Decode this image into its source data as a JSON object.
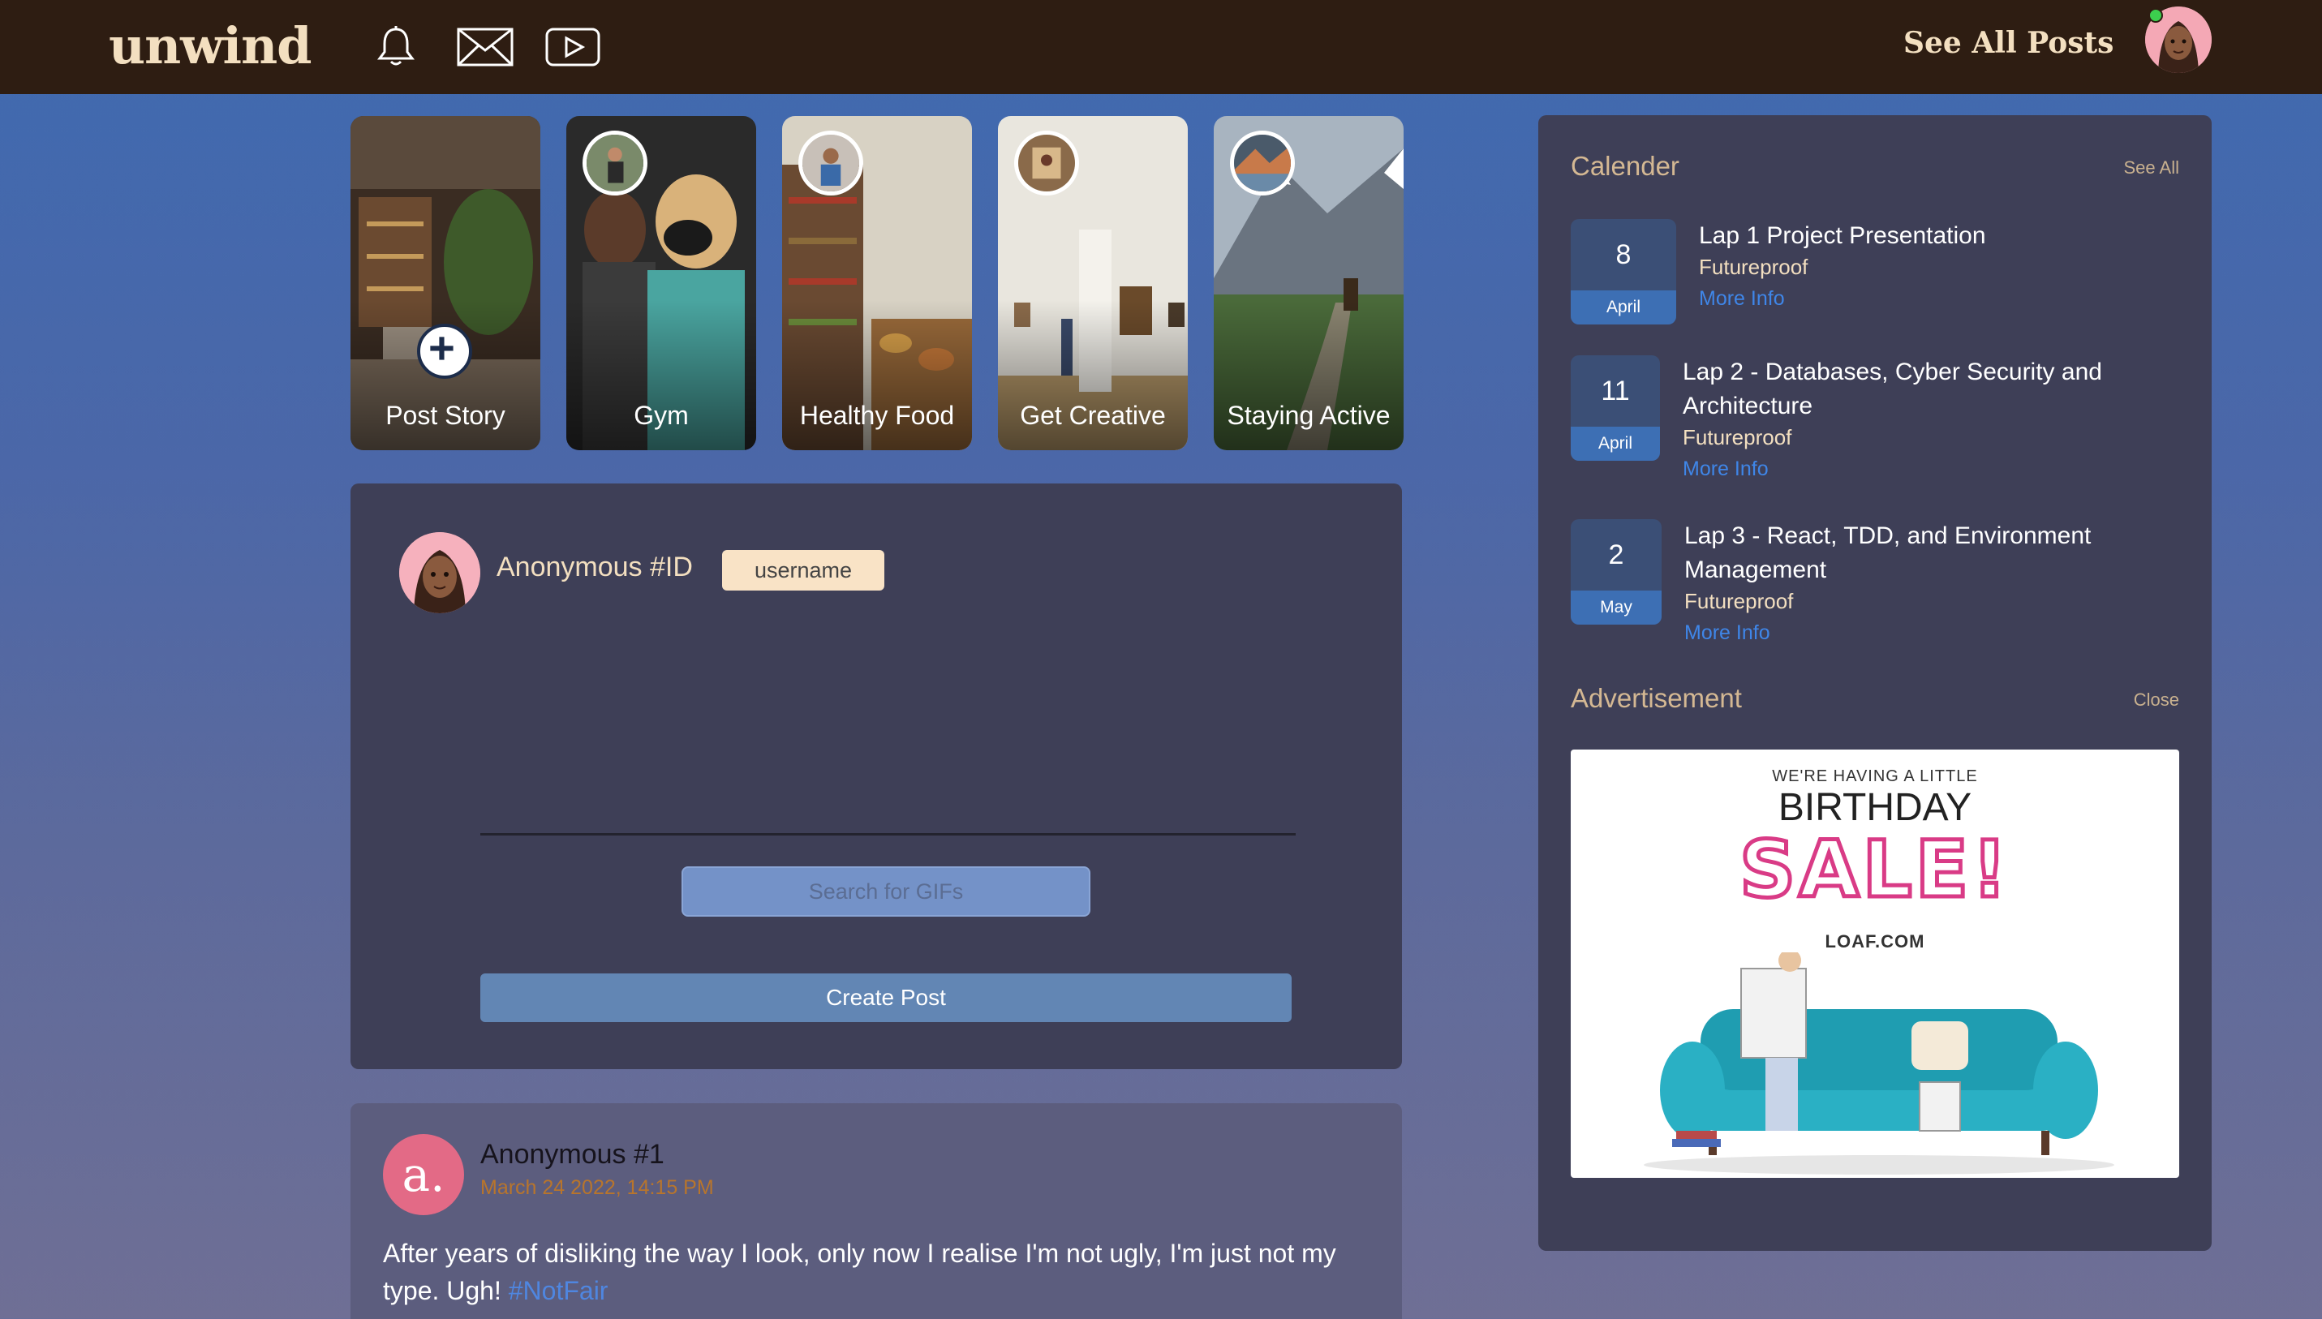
{
  "app": {
    "logo": "unwind",
    "see_all_posts": "See All Posts",
    "icons": [
      "bell-icon",
      "mail-icon",
      "video-play-icon"
    ],
    "brand_bg": "#2e1d12",
    "brand_text": "#f3dfc0"
  },
  "stories": [
    {
      "label": "Post Story",
      "type": "create"
    },
    {
      "label": "Gym"
    },
    {
      "label": "Healthy Food"
    },
    {
      "label": "Get Creative"
    },
    {
      "label": "Staying Active"
    }
  ],
  "composer": {
    "name": "Anonymous #ID",
    "username_placeholder": "username",
    "gif_search_placeholder": "Search for GIFs",
    "create_button": "Create Post"
  },
  "feed": [
    {
      "avatar_letter": "a.",
      "name": "Anonymous #1",
      "date": "March 24 2022, 14:15 PM",
      "body": "After years of disliking the way I look, only now I realise I'm not ugly, I'm just not my type. Ugh!",
      "hashtag": "#NotFair"
    }
  ],
  "calendar": {
    "title": "Calender",
    "see_all": "See All",
    "events": [
      {
        "day": "8",
        "month": "April",
        "title": "Lap 1 Project Presentation",
        "org": "Futureproof",
        "more": "More Info"
      },
      {
        "day": "11",
        "month": "April",
        "title": "Lap 2 - Databases, Cyber Security and Architecture",
        "org": "Futureproof",
        "more": "More Info"
      },
      {
        "day": "2",
        "month": "May",
        "title": "Lap 3 - React, TDD, and Environment Management",
        "org": "Futureproof",
        "more": "More Info"
      }
    ]
  },
  "advertisement": {
    "title": "Advertisement",
    "close": "Close",
    "line1": "WE'RE HAVING A LITTLE",
    "line2": "BIRTHDAY",
    "line3": "SALE!",
    "domain": "LOAF.COM",
    "accent": "#d93b86",
    "sofa_color": "#2ab0c4"
  }
}
